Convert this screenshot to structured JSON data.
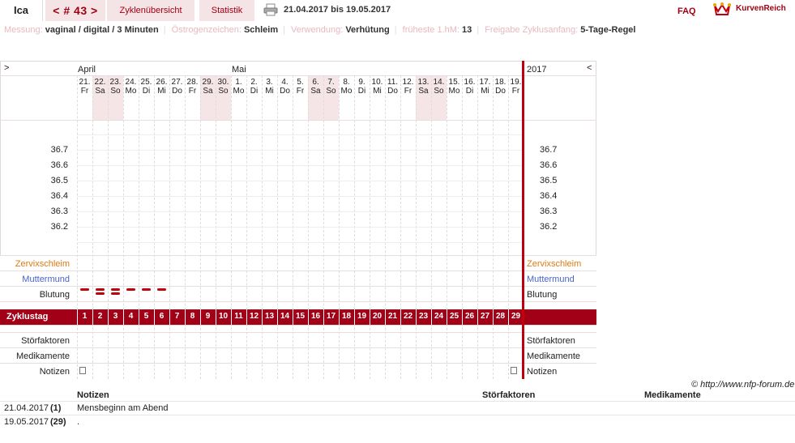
{
  "header": {
    "user": "Ica",
    "cycle_nav": "< # 43 >",
    "tabs": [
      {
        "label": "Zyklenübersicht"
      },
      {
        "label": "Statistik"
      }
    ],
    "date_range": "21.04.2017 bis 19.05.2017",
    "faq": "FAQ",
    "logo": "KurvenReich"
  },
  "info": [
    {
      "label": "Messung:",
      "value": "vaginal / digital / 3 Minuten"
    },
    {
      "label": "Östrogenzeichen:",
      "value": "Schleim"
    },
    {
      "label": "Verwendung:",
      "value": "Verhütung"
    },
    {
      "label": "früheste 1.hM:",
      "value": "13"
    },
    {
      "label": "Freigabe Zyklusanfang:",
      "value": "5-Tage-Regel"
    }
  ],
  "chart": {
    "nav_left": ">",
    "nav_right": "<",
    "year": "2017",
    "months": [
      "April",
      "Mai"
    ],
    "days": [
      {
        "d": "21.",
        "w": "Fr"
      },
      {
        "d": "22.",
        "w": "Sa"
      },
      {
        "d": "23.",
        "w": "So"
      },
      {
        "d": "24.",
        "w": "Mo"
      },
      {
        "d": "25.",
        "w": "Di"
      },
      {
        "d": "26.",
        "w": "Mi"
      },
      {
        "d": "27.",
        "w": "Do"
      },
      {
        "d": "28.",
        "w": "Fr"
      },
      {
        "d": "29.",
        "w": "Sa"
      },
      {
        "d": "30.",
        "w": "So"
      },
      {
        "d": "1.",
        "w": "Mo"
      },
      {
        "d": "2.",
        "w": "Di"
      },
      {
        "d": "3.",
        "w": "Mi"
      },
      {
        "d": "4.",
        "w": "Do"
      },
      {
        "d": "5.",
        "w": "Fr"
      },
      {
        "d": "6.",
        "w": "Sa"
      },
      {
        "d": "7.",
        "w": "So"
      },
      {
        "d": "8.",
        "w": "Mo"
      },
      {
        "d": "9.",
        "w": "Di"
      },
      {
        "d": "10.",
        "w": "Mi"
      },
      {
        "d": "11.",
        "w": "Do"
      },
      {
        "d": "12.",
        "w": "Fr"
      },
      {
        "d": "13.",
        "w": "Sa"
      },
      {
        "d": "14.",
        "w": "So"
      },
      {
        "d": "15.",
        "w": "Mo"
      },
      {
        "d": "16.",
        "w": "Di"
      },
      {
        "d": "17.",
        "w": "Mi"
      },
      {
        "d": "18.",
        "w": "Do"
      },
      {
        "d": "19.",
        "w": "Fr"
      }
    ],
    "temps": [
      "36.7",
      "36.6",
      "36.5",
      "36.4",
      "36.3",
      "36.2"
    ],
    "rows": {
      "zervix": "Zervixschleim",
      "muttermund": "Muttermund",
      "blutung": "Blutung",
      "zyklustag": "Zyklustag",
      "stoer": "Störfaktoren",
      "medi": "Medikamente",
      "notizen": "Notizen"
    },
    "bleeding_days": [
      1,
      2,
      3,
      4,
      5,
      6
    ],
    "bleeding_double_days": [
      2,
      3
    ],
    "note_days": [
      1,
      29
    ],
    "cycle_days": [
      "1",
      "2",
      "3",
      "4",
      "5",
      "6",
      "7",
      "8",
      "9",
      "10",
      "11",
      "12",
      "13",
      "14",
      "15",
      "16",
      "17",
      "18",
      "19",
      "20",
      "21",
      "22",
      "23",
      "24",
      "25",
      "26",
      "27",
      "28",
      "29"
    ],
    "colors": {
      "accent": "#c0000f",
      "band": "#a10016",
      "zervix": "#e07a10",
      "muttermund": "#4a63c8",
      "weekend": "#f5e5e7"
    }
  },
  "notes_table": {
    "copyright": "© http://www.nfp-forum.de",
    "headers": [
      "Notizen",
      "Störfaktoren",
      "Medikamente"
    ],
    "rows": [
      {
        "date": "21.04.2017",
        "day": "(1)",
        "note": "Mensbeginn am Abend"
      },
      {
        "date": "19.05.2017",
        "day": "(29)",
        "note": "."
      }
    ]
  }
}
